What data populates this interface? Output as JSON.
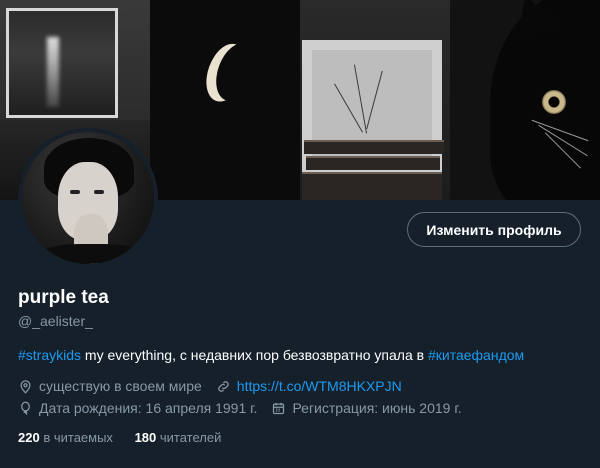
{
  "profile": {
    "display_name": "purple tea",
    "handle": "@_aelister_",
    "edit_button": "Изменить профиль"
  },
  "bio": {
    "hashtag1": "#straykids",
    "text": " my everything, с недавних пор безвозвратно упала в ",
    "hashtag2": "#китаефандом"
  },
  "meta": {
    "location": "существую в своем мире",
    "website": "https://t.co/WTM8HKXPJN",
    "birthday": "Дата рождения: 16 апреля 1991 г.",
    "joined": "Регистрация: июнь 2019 г."
  },
  "follow_stats": {
    "following_count": "220",
    "following_label": "в читаемых",
    "followers_count": "180",
    "followers_label": "читателей"
  },
  "colors": {
    "background": "#15202b",
    "accent": "#1d9bf0",
    "secondary_text": "#8899a6"
  },
  "icons": {
    "location": "map-pin-icon",
    "website": "link-icon",
    "birthday": "balloon-icon",
    "joined": "calendar-icon"
  }
}
